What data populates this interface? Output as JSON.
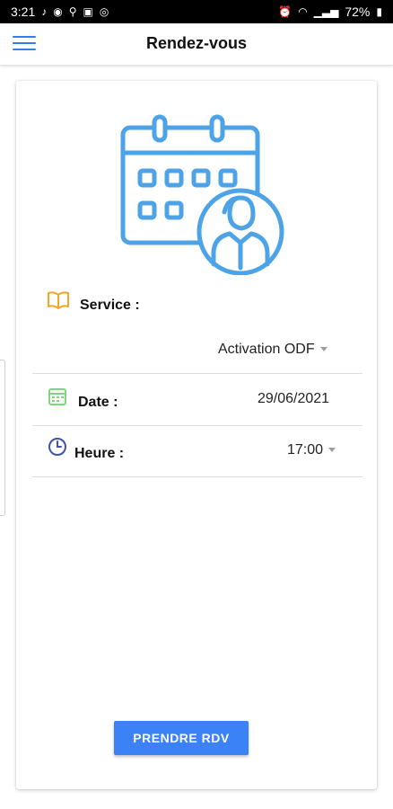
{
  "status_bar": {
    "time": "3:21",
    "battery": "72%",
    "icons_left": [
      "tiktok-icon",
      "messenger-icon",
      "usb-icon",
      "gallery-icon",
      "instagram-icon"
    ],
    "icons_right": [
      "alarm-icon",
      "wifi-icon",
      "signal-icon",
      "battery-icon"
    ]
  },
  "app_bar": {
    "title": "Rendez-vous"
  },
  "form": {
    "service": {
      "label": "Service :",
      "value": "Activation ODF",
      "icon": "book-icon",
      "icon_color": "#f5a623"
    },
    "date": {
      "label": "Date :",
      "value": "29/06/2021",
      "icon": "calendar-icon",
      "icon_color": "#7ed67e"
    },
    "time": {
      "label": "Heure :",
      "value": "17:00",
      "icon": "clock-icon",
      "icon_color": "#3f51b5"
    }
  },
  "submit_button": {
    "label": "PRENDRE RDV"
  },
  "colors": {
    "primary": "#3b82f6",
    "illustration": "#4da3e8"
  }
}
